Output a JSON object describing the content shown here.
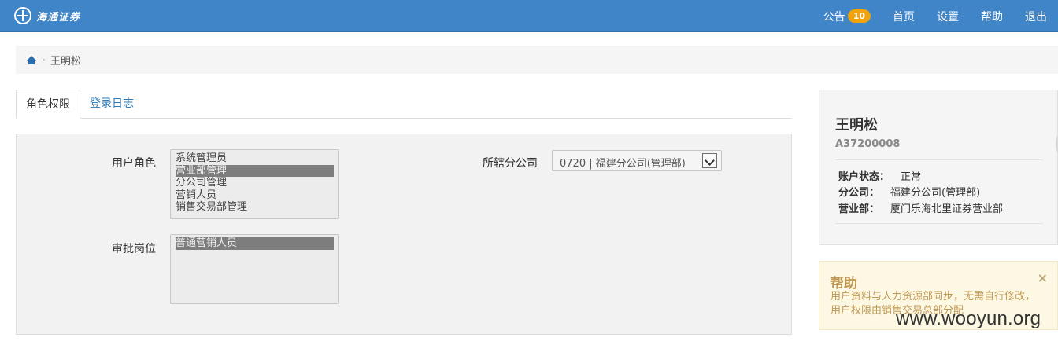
{
  "topbar": {
    "brand": "海通证券",
    "nav": {
      "notice_label": "公告",
      "notice_count": "10",
      "home": "首页",
      "settings": "设置",
      "help": "帮助",
      "logout": "退出"
    }
  },
  "breadcrumb": {
    "separator": "·",
    "current": "王明松"
  },
  "tabs": [
    {
      "label": "角色权限",
      "active": true
    },
    {
      "label": "登录日志",
      "active": false
    }
  ],
  "form": {
    "user_role": {
      "label": "用户角色",
      "options": [
        "系统管理员",
        "营业部管理",
        "分公司管理",
        "营销人员",
        "销售交易部管理"
      ],
      "selected": "营业部管理"
    },
    "approval_post": {
      "label": "审批岗位",
      "options": [
        "普通营销人员"
      ],
      "selected": "普通营销人员"
    },
    "branch": {
      "label": "所辖分公司",
      "value": "0720 | 福建分公司(管理部)"
    }
  },
  "profile": {
    "name": "王明松",
    "account": "A37200008",
    "rows": [
      {
        "key": "账户状态：",
        "value": "正常"
      },
      {
        "key": "分公司：",
        "value": "福建分公司(管理部)"
      },
      {
        "key": "营业部：",
        "value": "厦门乐海北里证券营业部"
      }
    ]
  },
  "help_box": {
    "title": "帮助",
    "text": "用户资料与人力资源部同步，无需自行修改，用户权限由销售交易总部分配",
    "close": "×"
  },
  "watermark": "www.wooyun.org",
  "colors": {
    "topbar": "#3f85c8",
    "badge": "#f0a30a",
    "link": "#2a7ab8",
    "help_text": "#c09853"
  }
}
